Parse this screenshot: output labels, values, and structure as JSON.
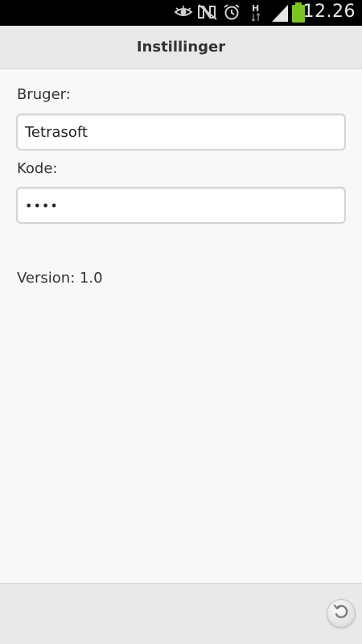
{
  "status_bar": {
    "time": "12.26",
    "icons": [
      "eye-icon",
      "nfc-off-icon",
      "alarm-icon",
      "h-data-icon",
      "signal-icon",
      "battery-icon"
    ],
    "battery_color": "#7cc424"
  },
  "header": {
    "title": "Instillinger"
  },
  "form": {
    "user_label": "Bruger:",
    "user_value": "Tetrasoft",
    "password_label": "Kode:",
    "password_value": "••••"
  },
  "version_text": "Version: 1.0",
  "footer": {
    "back_icon": "undo-icon"
  }
}
